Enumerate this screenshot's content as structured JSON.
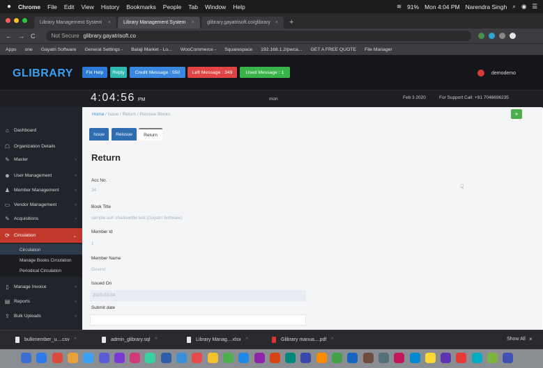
{
  "mac_menu": {
    "items": [
      "Chrome",
      "File",
      "Edit",
      "View",
      "History",
      "Bookmarks",
      "People",
      "Tab",
      "Window",
      "Help"
    ],
    "battery": "91%",
    "clock": "Mon 4:04 PM",
    "user": "Narendra Singh"
  },
  "browser": {
    "tabs": [
      {
        "label": "Library Management System",
        "active": false
      },
      {
        "label": "Library Management System",
        "active": true
      },
      {
        "label": "glibrary.gayatrisoft.co/glibrary",
        "active": false
      }
    ],
    "url_security": "Not Secure",
    "url": "glibrary.gayatrisoft.co",
    "bookmarks": [
      "Apps",
      "one",
      "Gayatri Software",
      "General Settings -",
      "Balaji Market - Lo...",
      "WooCommerce -",
      "Squarespace",
      "192.168.1.2/pwca...",
      "GET A FREE QUOTE",
      "File Manager"
    ],
    "colors": {
      "dot_close": "#ff5f57",
      "dot_min": "#febc2e",
      "dot_max": "#28c840"
    }
  },
  "header": {
    "logo": "GLIBRARY",
    "buttons": [
      {
        "label": "Fix Help",
        "color": "#2b7bd6"
      },
      {
        "label": "Reply",
        "color": "#2eb8b0"
      },
      {
        "label": "Credit Message : 550",
        "color": "#3a87e0"
      },
      {
        "label": "Left Message : 349",
        "color": "#e04444"
      },
      {
        "label": "Used Message : 1",
        "color": "#38b44a"
      }
    ],
    "user_label": "demodemo",
    "time": "4:04:56",
    "ampm": "PM",
    "day": "mon",
    "date": "Feb 3 2020",
    "support": "For Support Call: +91 7046696235"
  },
  "sidebar": {
    "items": [
      {
        "label": "Dashboard",
        "icon": "home-icon",
        "glyph": "⌂"
      },
      {
        "label": "Organization Details",
        "icon": "org-icon",
        "glyph": "☖"
      },
      {
        "label": "Master",
        "icon": "wrench-icon",
        "glyph": "✎"
      },
      {
        "label": "User Management",
        "icon": "user-icon",
        "glyph": "☻"
      },
      {
        "label": "Member Management",
        "icon": "members-icon",
        "glyph": "♟"
      },
      {
        "label": "Vendor Management",
        "icon": "vendor-icon",
        "glyph": "▭"
      },
      {
        "label": "Acquisitions",
        "icon": "pen-icon",
        "glyph": "✎"
      },
      {
        "label": "Circulation",
        "icon": "link-icon",
        "glyph": "⟳"
      }
    ],
    "sub_items": [
      "Circulation",
      "Manage Books Circulation",
      "Periodical Circulation"
    ],
    "items_after": [
      {
        "label": "Manage Invoice",
        "icon": "invoice-icon",
        "glyph": "▯"
      },
      {
        "label": "Reports",
        "icon": "chart-icon",
        "glyph": "▤"
      },
      {
        "label": "Bulk Uploads",
        "icon": "upload-icon",
        "glyph": "⇪"
      }
    ]
  },
  "content": {
    "breadcrumb": {
      "home": "Home",
      "trail": "/ Issue / Return / Reissue Books"
    },
    "tabs": [
      {
        "label": "Issue",
        "active": false
      },
      {
        "label": "Reissue",
        "active": false
      },
      {
        "label": "Return",
        "active": true
      }
    ],
    "title": "Return",
    "fields": [
      {
        "label": "Acc No.",
        "value": "34"
      },
      {
        "label": "Book Title",
        "value": "sample aoh shadowtitle test (Gayatri Software)"
      },
      {
        "label": "Member Id",
        "value": "1"
      },
      {
        "label": "Member Name",
        "value": "Govind"
      },
      {
        "label": "Issued On",
        "value": "2020-02-04"
      },
      {
        "label": "Submit date",
        "value": ""
      }
    ]
  },
  "downloads": {
    "items": [
      "bulkmember_u....csv",
      "admin_glibrary.sql",
      "Library Manag....xlsx",
      "Glibrary manua....pdf"
    ],
    "show_all": "Show All"
  },
  "dock": {
    "icon_colors": [
      "#3b6fd1",
      "#2d7be6",
      "#d94a3a",
      "#e8a23a",
      "#3aa0f3",
      "#5b5bd6",
      "#7a3ad1",
      "#d13a7a",
      "#3ad1a0",
      "#2c5fa8",
      "#3a8fd9",
      "#e84a4a",
      "#f2c12e",
      "#4caf50",
      "#1e88e5",
      "#8e24aa",
      "#d84315",
      "#00897b",
      "#3949ab",
      "#fb8c00",
      "#43a047",
      "#1565c0",
      "#6d4c41",
      "#546e7a",
      "#c2185b",
      "#0288d1",
      "#fdd835",
      "#5e35b1",
      "#e53935",
      "#00acc1",
      "#7cb342",
      "#3f51b5"
    ]
  }
}
